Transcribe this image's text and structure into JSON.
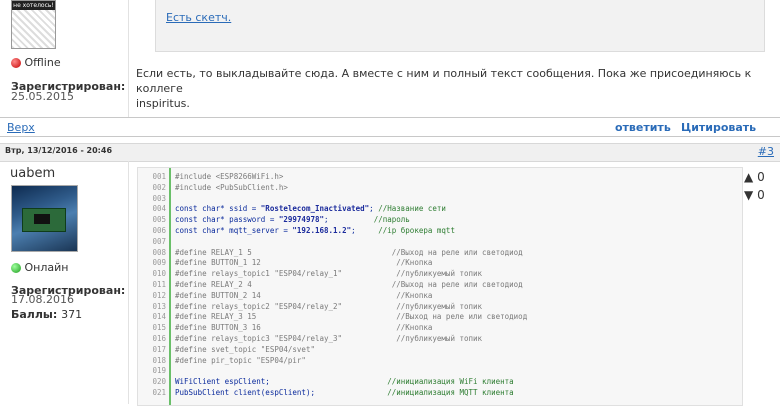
{
  "post1": {
    "avatar_caption": "не хотелось!",
    "status": "Offline",
    "registered_label": "Зарегистрирован:",
    "registered_date": "25.05.2015",
    "quote_link": "Есть скетч.",
    "body_line1": "Если есть, то выкладывайте сюда. А вместе с ним и полный текст сообщения. Пока же присоединяюсь к коллеге",
    "body_line2": "inspiritus.",
    "footer": {
      "top_link": "Верх",
      "reply": "ответить",
      "quote": "Цитировать"
    }
  },
  "post2": {
    "date": "Втр, 13/12/2016 - 20:46",
    "number": "#3",
    "username": "uabem",
    "status": "Онлайн",
    "registered_label": "Зарегистрирован:",
    "registered_date": "17.08.2016",
    "points_label": "Баллы:",
    "points_value": "371",
    "vote_up": "0",
    "vote_down": "0",
    "up_icon": "▲",
    "down_icon": "▼"
  },
  "code": {
    "line_numbers": [
      "001",
      "002",
      "003",
      "004",
      "005",
      "006",
      "007",
      "008",
      "009",
      "010",
      "011",
      "012",
      "013",
      "014",
      "015",
      "016",
      "017",
      "018",
      "019",
      "020",
      "021"
    ],
    "lines": [
      [
        {
          "c": "pp",
          "t": "#include <ESP8266WiFi.h>"
        }
      ],
      [
        {
          "c": "pp",
          "t": "#include <PubSubClient.h>"
        }
      ],
      [
        {
          "c": "pp",
          "t": ""
        }
      ],
      [
        {
          "c": "kw",
          "t": "const char* ssid = "
        },
        {
          "c": "str",
          "t": "\"Rostelecom_Inactivated\""
        },
        {
          "c": "kw",
          "t": "; "
        },
        {
          "c": "cmg",
          "t": "//Название сети"
        }
      ],
      [
        {
          "c": "kw",
          "t": "const char* password = "
        },
        {
          "c": "str",
          "t": "\"29974978\""
        },
        {
          "c": "kw",
          "t": ";          "
        },
        {
          "c": "cmg",
          "t": "//пароль"
        }
      ],
      [
        {
          "c": "kw",
          "t": "const char* mqtt_server = "
        },
        {
          "c": "str",
          "t": "\"192.168.1.2\""
        },
        {
          "c": "kw",
          "t": ";     "
        },
        {
          "c": "cmg",
          "t": "//ip брокера mqtt"
        }
      ],
      [
        {
          "c": "pp",
          "t": ""
        }
      ],
      [
        {
          "c": "pp",
          "t": "#define RELAY_1 5                               "
        },
        {
          "c": "cm",
          "t": "//Выход на реле или светодиод"
        }
      ],
      [
        {
          "c": "pp",
          "t": "#define BUTTON_1 12                              "
        },
        {
          "c": "cm",
          "t": "//Кнопка"
        }
      ],
      [
        {
          "c": "pp",
          "t": "#define relays_topic1 \"ESP04/relay_1\"            "
        },
        {
          "c": "cm",
          "t": "//публикуемый топик"
        }
      ],
      [
        {
          "c": "pp",
          "t": "#define RELAY_2 4                               "
        },
        {
          "c": "cm",
          "t": "//Выход на реле или светодиод"
        }
      ],
      [
        {
          "c": "pp",
          "t": "#define BUTTON_2 14                              "
        },
        {
          "c": "cm",
          "t": "//Кнопка"
        }
      ],
      [
        {
          "c": "pp",
          "t": "#define relays_topic2 \"ESP04/relay_2\"            "
        },
        {
          "c": "cm",
          "t": "//публикуемый топик"
        }
      ],
      [
        {
          "c": "pp",
          "t": "#define RELAY_3 15                               "
        },
        {
          "c": "cm",
          "t": "//Выход на реле или светодиод"
        }
      ],
      [
        {
          "c": "pp",
          "t": "#define BUTTON_3 16                              "
        },
        {
          "c": "cm",
          "t": "//Кнопка"
        }
      ],
      [
        {
          "c": "pp",
          "t": "#define relays_topic3 \"ESP04/relay_3\"            "
        },
        {
          "c": "cm",
          "t": "//публикуемый топик"
        }
      ],
      [
        {
          "c": "pp",
          "t": "#define svet_topic \"ESP04/svet\""
        }
      ],
      [
        {
          "c": "pp",
          "t": "#define pir_topic \"ESP04/pir\""
        }
      ],
      [
        {
          "c": "pp",
          "t": ""
        }
      ],
      [
        {
          "c": "kw",
          "t": "WiFiClient espClient;                          "
        },
        {
          "c": "cmg",
          "t": "//инициализация WiFi клиента"
        }
      ],
      [
        {
          "c": "kw",
          "t": "PubSubClient client(espClient);                "
        },
        {
          "c": "cmg",
          "t": "//инициализация MQTT клиента"
        }
      ]
    ]
  }
}
